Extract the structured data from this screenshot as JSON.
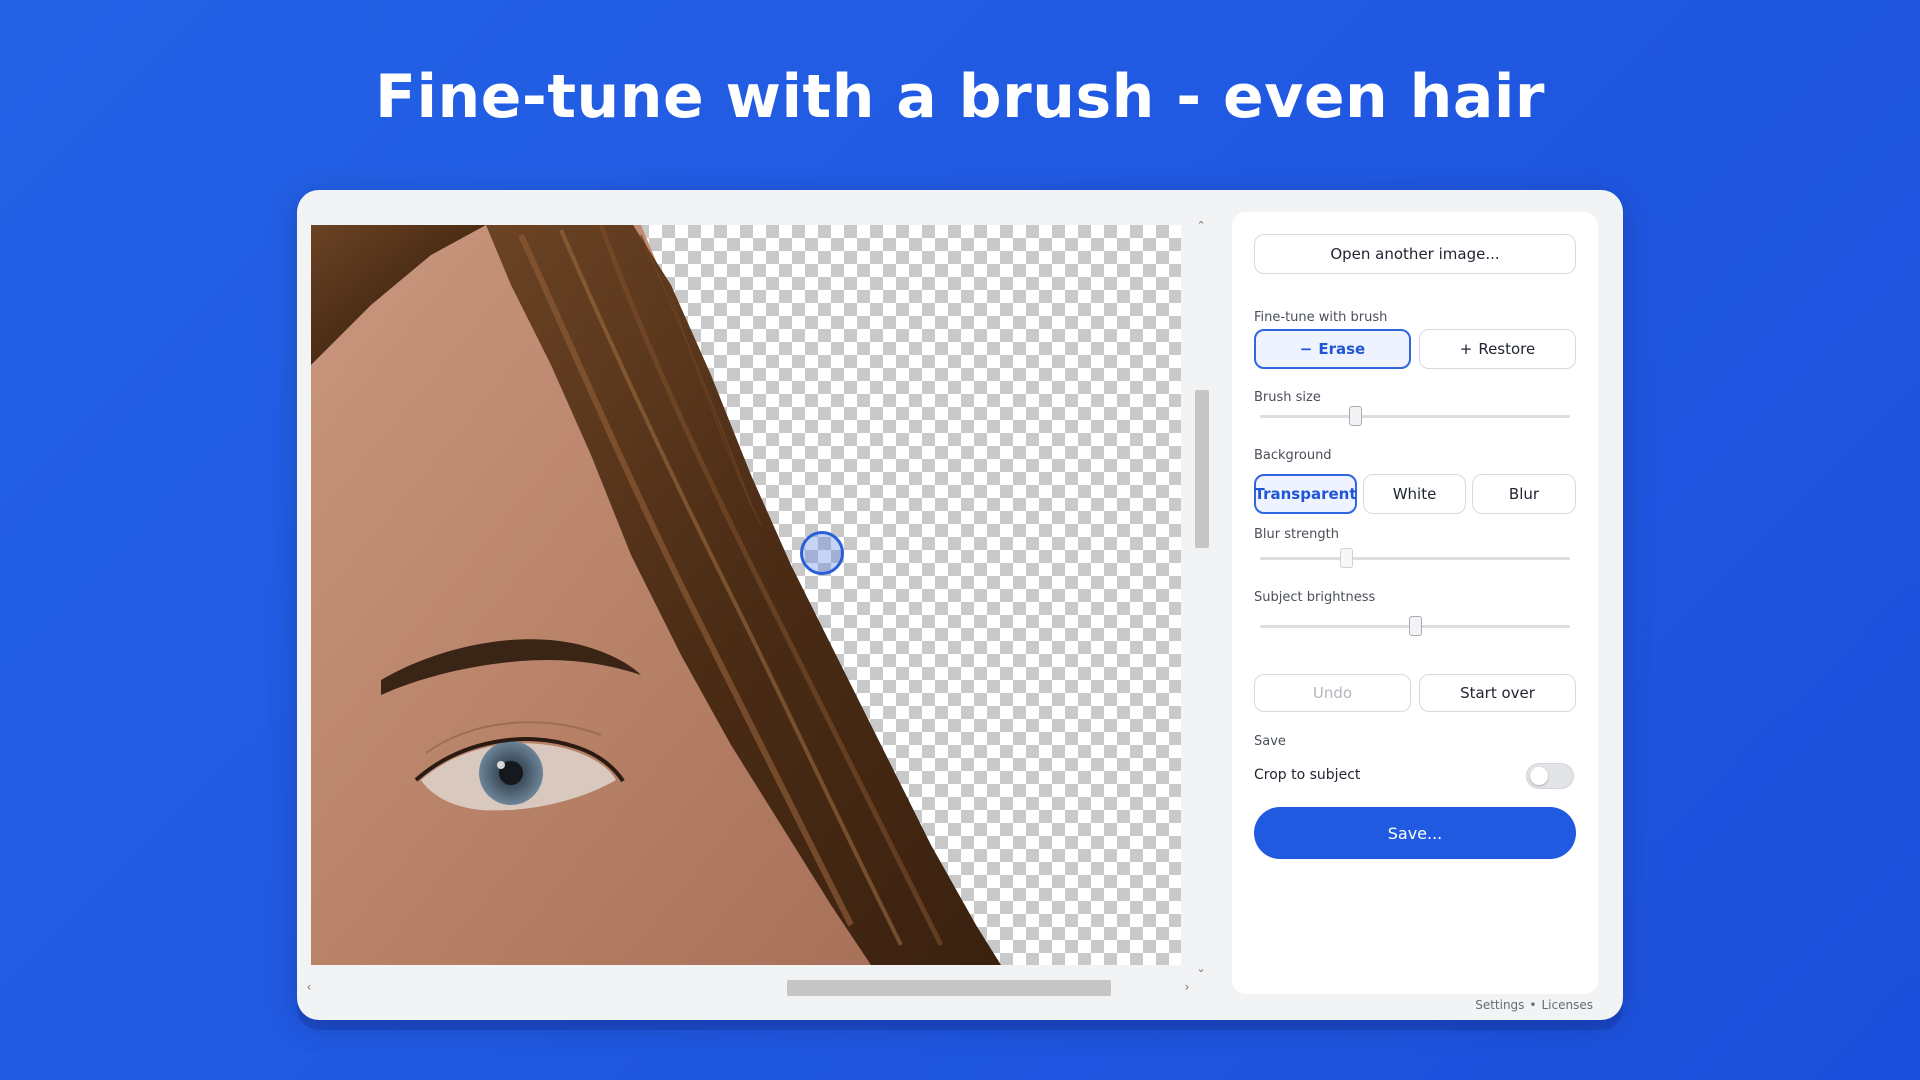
{
  "headline": "Fine-tune with a brush - even hair",
  "panel": {
    "open_button": "Open another image...",
    "finetune_label": "Fine-tune with brush",
    "erase_label": "Erase",
    "restore_label": "Restore",
    "brush_size_label": "Brush size",
    "brush_size_fraction": 0.3,
    "background_label": "Background",
    "bg_transparent": "Transparent",
    "bg_white": "White",
    "bg_blur": "Blur",
    "blur_strength_label": "Blur strength",
    "blur_strength_fraction": 0.27,
    "brightness_label": "Subject brightness",
    "brightness_fraction": 0.5,
    "undo_label": "Undo",
    "start_over_label": "Start over",
    "save_section_label": "Save",
    "crop_label": "Crop to subject",
    "save_button": "Save..."
  },
  "footer": {
    "settings": "Settings",
    "separator": "•",
    "licenses": "Licenses"
  },
  "icons": {
    "minus": "−",
    "plus": "+",
    "up": "⌃",
    "down": "⌄",
    "left": "‹",
    "right": "›"
  },
  "colors": {
    "background": "#2462e6",
    "accent": "#1f5ae0",
    "selected_border": "#2f66e0"
  }
}
